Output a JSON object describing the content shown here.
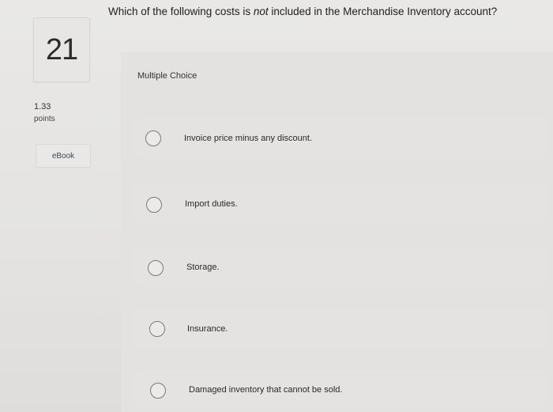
{
  "question": {
    "number": "21",
    "points_value": "1.33",
    "points_label": "points",
    "ebook_label": "eBook",
    "prompt_before": "Which of the following costs is ",
    "prompt_emphasis": "not",
    "prompt_after": " included in the Merchandise Inventory account?",
    "type_label": "Multiple Choice"
  },
  "options": [
    {
      "label": "Invoice price minus any discount."
    },
    {
      "label": "Import duties."
    },
    {
      "label": "Storage."
    },
    {
      "label": "Insurance."
    },
    {
      "label": "Damaged inventory that cannot be sold."
    }
  ]
}
